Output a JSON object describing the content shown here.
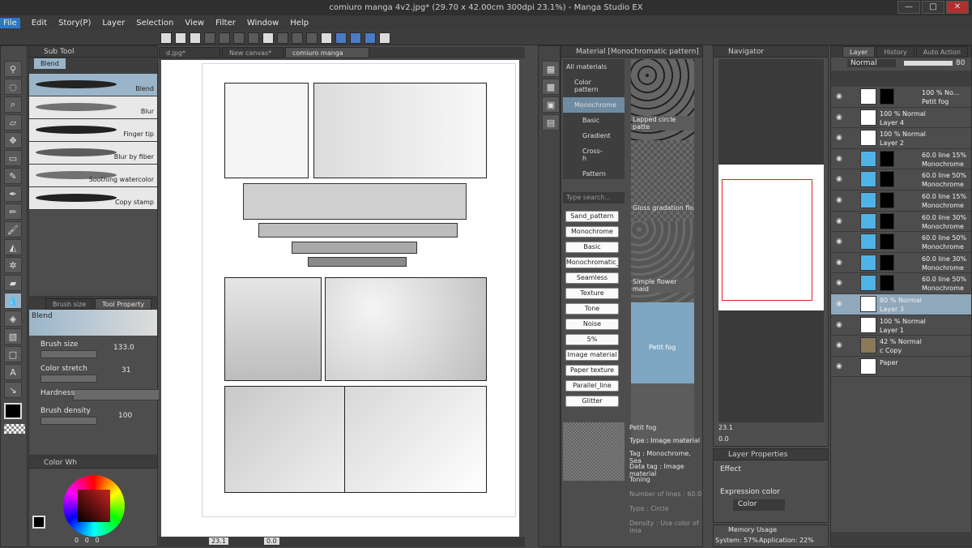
{
  "window": {
    "title": "comiuro manga 4v2.jpg* (29.70 x 42.00cm 300dpi 23.1%) - Manga Studio EX",
    "controls": [
      "—",
      "□",
      "✕"
    ]
  },
  "menu": [
    "File",
    "Edit",
    "Story(P)",
    "Layer",
    "Selection",
    "View",
    "Filter",
    "Window",
    "Help"
  ],
  "subtool": {
    "header": "Sub Tool",
    "group": "Blend",
    "brushes": [
      "Blend",
      "Blur",
      "Finger tip",
      "Blur by fiber",
      "Soothing watercolor",
      "Copy stamp"
    ]
  },
  "toolprop": {
    "tabs": [
      "Brush size",
      "Tool Property"
    ],
    "title": "Blend",
    "brush_size_label": "Brush size",
    "brush_size": "133.0",
    "color_stretch_label": "Color stretch",
    "color_stretch": "31",
    "hardness_label": "Hardness",
    "brush_density_label": "Brush density",
    "brush_density": "100"
  },
  "colorwheel": {
    "header": "Color Wh",
    "rgb": [
      "0",
      "0",
      "0"
    ]
  },
  "doc_tabs": [
    "d.jpg*",
    "New canvas*",
    "comiuro manga 4v2.jpg*"
  ],
  "status": {
    "zoom": "23.1",
    "angle": "0.0"
  },
  "material": {
    "header": "Material [Monochromatic pattern]",
    "tree": [
      "All materials",
      "Color pattern",
      "Monochrome",
      "Basic",
      "Gradient",
      "Cross-h",
      "Pattern"
    ],
    "search_placeholder": "Type search...",
    "tags": [
      "Sand_pattern",
      "Monochrome",
      "Basic",
      "Monochromatic_",
      "Seamless",
      "Texture",
      "Tone",
      "Noise",
      "5%",
      "Image material",
      "Paper texture",
      "Parallel_line",
      "Glitter"
    ],
    "swatches": [
      "Lapped circle patte",
      "Gloss gradation flo",
      "Simple flower maid",
      "Petit fog"
    ],
    "detail": {
      "name": "Petit fog",
      "type": "Type : Image material",
      "tag": "Tag : Monochrome, Sea",
      "datatag": "Data tag : Image material",
      "toning": "Toning",
      "lines": "Number of lines : 60.0",
      "type2": "Type : Circle",
      "density": "Density : Use color of ima"
    }
  },
  "navigator": {
    "header": "Navigator",
    "zoom": "23.1",
    "angle": "0.0"
  },
  "layerprops": {
    "header": "Layer Properties",
    "effect_label": "Effect",
    "expr_label": "Expression color",
    "expr_value": "Color"
  },
  "memory": {
    "header": "Memory Usage",
    "system": "System: 57%",
    "application": "Application: 22%"
  },
  "layers": {
    "tabs": [
      "Layer",
      "History",
      "Auto Action"
    ],
    "blend_mode": "Normal",
    "opacity": "80",
    "rows": [
      {
        "l1": "100 % No...",
        "l2": "Petit fog",
        "type": "fog"
      },
      {
        "l1": "100 %  Normal",
        "l2": "Layer 4",
        "type": "plain"
      },
      {
        "l1": "100 %  Normal",
        "l2": "Layer 2",
        "type": "plain"
      },
      {
        "l1": "60.0 line 15%",
        "l2": "Monochrome",
        "type": "tone"
      },
      {
        "l1": "60.0 line 50%",
        "l2": "Monochrome",
        "type": "tone"
      },
      {
        "l1": "60.0 line 15%",
        "l2": "Monochrome",
        "type": "tone"
      },
      {
        "l1": "60.0 line 30%",
        "l2": "Monochrome",
        "type": "tone"
      },
      {
        "l1": "60.0 line 50%",
        "l2": "Monochrome",
        "type": "tone"
      },
      {
        "l1": "60.0 line 30%",
        "l2": "Monochrome",
        "type": "tone"
      },
      {
        "l1": "60.0 line 50%",
        "l2": "Monochrome",
        "type": "tone"
      },
      {
        "l1": "80 %  Normal",
        "l2": "Layer 3",
        "type": "sel"
      },
      {
        "l1": "100 %  Normal",
        "l2": "Layer 1",
        "type": "plain"
      },
      {
        "l1": "42 %  Normal",
        "l2": "c Copy",
        "type": "copy"
      },
      {
        "l1": "",
        "l2": "Paper",
        "type": "paper"
      }
    ]
  },
  "colors": {
    "accent": "#2a78c8",
    "selected": "#8fa8bc",
    "panel": "#4d4d4d"
  }
}
